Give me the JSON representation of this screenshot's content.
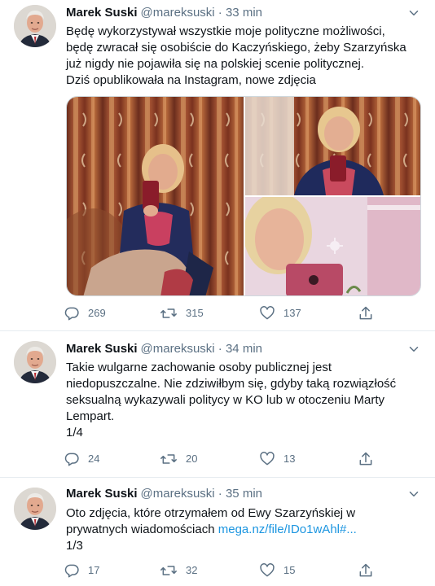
{
  "tweets": [
    {
      "author_name": "Marek Suski",
      "handle": "@mareksuski",
      "time": "33 min",
      "lines": [
        "Będę wykorzystywał wszystkie moje polityczne możliwości,",
        "będę zwracał się osobiście do Kaczyńskiego, żeby Szarzyńska",
        "już nigdy nie pojawiła się na polskiej scenie politycznej.",
        "Dziś opublikowała na Instagram, nowe zdjęcia"
      ],
      "replies": "269",
      "retweets": "315",
      "likes": "137"
    },
    {
      "author_name": "Marek Suski",
      "handle": "@mareksuski",
      "time": "34 min",
      "lines": [
        "Takie wulgarne zachowanie osoby publicznej jest",
        "niedopuszczalne. Nie zdziwiłbym się, gdyby taką rozwiązłość",
        "seksualną wykazywali politycy w KO lub w otoczeniu Marty",
        "Lempart.",
        "1/4"
      ],
      "replies": "24",
      "retweets": "20",
      "likes": "13"
    },
    {
      "author_name": "Marek Suski",
      "handle": "@mareksuski",
      "time": "35 min",
      "line1": "Oto zdjęcia, które otrzymałem od Ewy Szarzyńskiej w",
      "line2_text": "prywatnych wiadomościach ",
      "line2_link": "mega.nz/file/IDo1wAhl#...",
      "line3": "1/3",
      "replies": "17",
      "retweets": "32",
      "likes": "15"
    }
  ],
  "icons": {
    "reply": "reply-icon",
    "retweet": "retweet-icon",
    "like": "heart-icon",
    "share": "share-icon",
    "more": "chevron-down-icon"
  },
  "colors": {
    "text": "#0f1419",
    "secondary": "#5b7083",
    "link": "#1b95e0",
    "divider": "#e6ecf0"
  }
}
